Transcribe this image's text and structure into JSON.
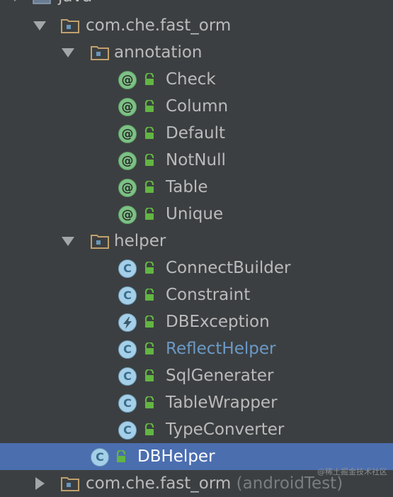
{
  "tree": {
    "root": {
      "label": "java",
      "icon": "source-folder-icon",
      "expanded": true
    },
    "package_main": {
      "label": "com.che.fast_orm",
      "icon": "package-folder-icon",
      "expanded": true
    },
    "package_annotation": {
      "label": "annotation",
      "icon": "package-folder-icon",
      "expanded": true,
      "items": [
        {
          "label": "Check",
          "kind": "annotation",
          "badge": "@",
          "icon": "annotation-icon"
        },
        {
          "label": "Column",
          "kind": "annotation",
          "badge": "@",
          "icon": "annotation-icon"
        },
        {
          "label": "Default",
          "kind": "annotation",
          "badge": "@",
          "icon": "annotation-icon"
        },
        {
          "label": "NotNull",
          "kind": "annotation",
          "badge": "@",
          "icon": "annotation-icon"
        },
        {
          "label": "Table",
          "kind": "annotation",
          "badge": "@",
          "icon": "annotation-icon"
        },
        {
          "label": "Unique",
          "kind": "annotation",
          "badge": "@",
          "icon": "annotation-icon"
        }
      ]
    },
    "package_helper": {
      "label": "helper",
      "icon": "package-folder-icon",
      "expanded": true,
      "items": [
        {
          "label": "ConnectBuilder",
          "kind": "class",
          "badge": "C",
          "icon": "class-icon"
        },
        {
          "label": "Constraint",
          "kind": "class",
          "badge": "C",
          "icon": "class-icon"
        },
        {
          "label": "DBException",
          "kind": "exception",
          "badge": "",
          "icon": "exception-class-icon"
        },
        {
          "label": "ReflectHelper",
          "kind": "class",
          "badge": "C",
          "icon": "class-icon",
          "modified": true
        },
        {
          "label": "SqlGenerater",
          "kind": "class",
          "badge": "C",
          "icon": "class-icon"
        },
        {
          "label": "TableWrapper",
          "kind": "class",
          "badge": "C",
          "icon": "class-icon"
        },
        {
          "label": "TypeConverter",
          "kind": "class",
          "badge": "C",
          "icon": "class-icon"
        }
      ]
    },
    "selected_item": {
      "label": "DBHelper",
      "kind": "class",
      "badge": "C",
      "icon": "class-icon",
      "selected": true
    },
    "package_test": {
      "label": "com.che.fast_orm",
      "suffix": "(androidTest)",
      "icon": "package-folder-icon",
      "expanded": false
    }
  },
  "colors": {
    "background": "#3c3f41",
    "selection": "#4b6eaf",
    "text": "#bbbbbb",
    "modified_text": "#6b9ac8",
    "annotation_badge": "#7cc185",
    "class_badge": "#a5cfe8",
    "lock": "#62b543"
  },
  "watermark": {
    "text": "@稀土掘金技术社区"
  }
}
